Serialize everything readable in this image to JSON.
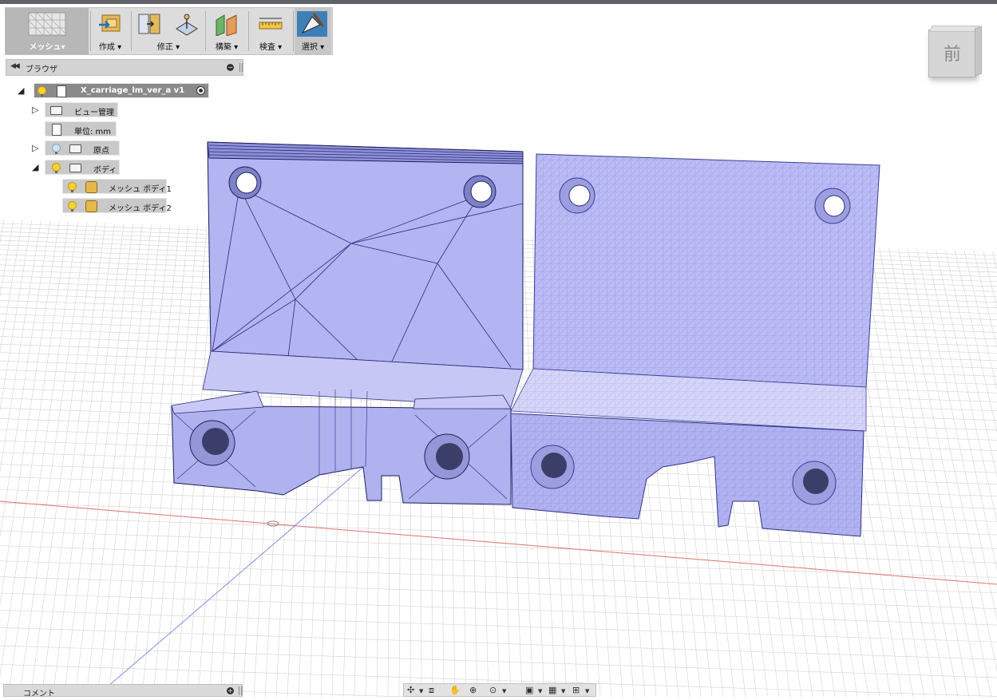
{
  "toolbar": {
    "mesh_label": "メッシュ▾",
    "create_label": "作成 ▾",
    "modify_label": "修正 ▾",
    "construct_label": "構築 ▾",
    "inspect_label": "検査 ▾",
    "select_label": "選択 ▾"
  },
  "browser": {
    "title": "ブラウザ",
    "root_label": "X_carriage_lm_ver_a v1",
    "items": [
      {
        "label": "ビュー管理"
      },
      {
        "label": "単位: mm"
      },
      {
        "label": "原点"
      },
      {
        "label": "ボディ"
      },
      {
        "label": "メッシュ ボディ1"
      },
      {
        "label": "メッシュ ボディ2"
      }
    ]
  },
  "viewcube": {
    "face_label": "前"
  },
  "comments": {
    "title": "コメント"
  },
  "colors": {
    "mesh_fill": "#b4b5f0",
    "mesh_edge": "#2c2f7a",
    "grid_line": "#d2d2d2",
    "axis_red": "#e07070",
    "axis_blue": "#7b8fe0",
    "panel_bg": "#dcdcdc"
  },
  "icons": {
    "nav": [
      "orbit-icon",
      "look-at-icon",
      "pan-icon",
      "zoom-icon",
      "fit-icon",
      "display-mode-icon",
      "grid-icon",
      "viewports-icon"
    ]
  }
}
